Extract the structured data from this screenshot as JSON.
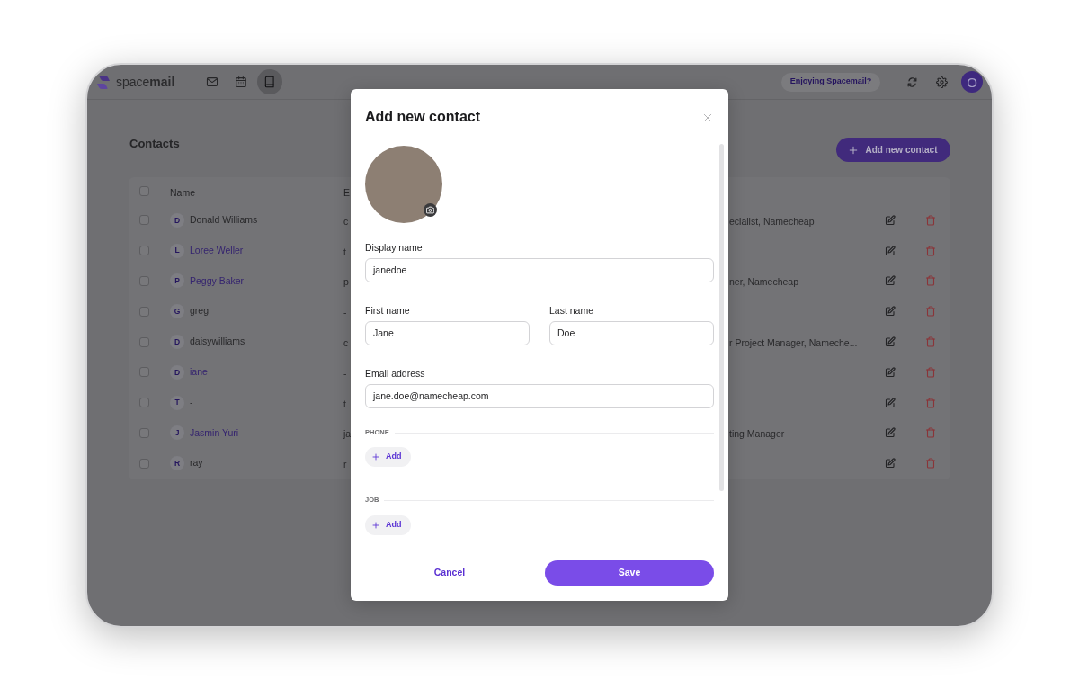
{
  "app": {
    "logo": "space**mail**",
    "nav": [
      {
        "kind": "mail",
        "selected": false
      },
      {
        "kind": "calendar",
        "selected": false
      },
      {
        "kind": "contacts",
        "selected": true
      }
    ],
    "feedback_button": "Enjoying Spacemail?",
    "avatar": "O"
  },
  "page": {
    "title": "Contacts",
    "add_button": "Add new contact"
  },
  "table": {
    "select_all": {
      "checked": false
    },
    "columns": [
      "Name",
      "E"
    ],
    "rows": [
      {
        "checked": false,
        "initial": "D",
        "name": "Donald Williams",
        "highlighted": false,
        "column_2": "c",
        "column_3": "ecialist, Namecheap"
      },
      {
        "checked": false,
        "initial": "L",
        "name": "Loree Weller",
        "highlighted": true,
        "column_2": "t"
      },
      {
        "checked": false,
        "initial": "P",
        "name": "Peggy Baker",
        "highlighted": true,
        "column_2": "p",
        "column_3": "ner, Namecheap"
      },
      {
        "checked": false,
        "initial": "G",
        "name": "greg",
        "highlighted": false,
        "column_2": "-"
      },
      {
        "checked": false,
        "initial": "D",
        "name": "daisywilliams",
        "highlighted": false,
        "column_2": "c",
        "column_3": "r Project Manager, Nameche..."
      },
      {
        "checked": false,
        "initial": "D",
        "name": "iane",
        "highlighted": true,
        "column_2": "-"
      },
      {
        "checked": false,
        "initial": "T",
        "name": "-",
        "highlighted": false,
        "column_2": "t"
      },
      {
        "checked": false,
        "initial": "J",
        "name": "Jasmin Yuri",
        "highlighted": true,
        "column_2": "ja",
        "column_3": "ting Manager"
      },
      {
        "checked": false,
        "initial": "R",
        "name": "ray",
        "highlighted": false,
        "column_2": "r"
      }
    ]
  },
  "dialog": {
    "title": "Add new contact",
    "fields": [
      [
        {
          "label": "Display name",
          "value": "janedoe"
        }
      ],
      [
        {
          "label": "First name",
          "value": "Jane"
        },
        {
          "label": "Last name",
          "value": "Doe"
        }
      ],
      [
        {
          "label": "Email address",
          "value": "jane.doe@namecheap.com"
        }
      ]
    ],
    "sections": [
      {
        "label": "PHONE",
        "button": "Add"
      },
      {
        "label": "JOB",
        "button": "Add"
      }
    ],
    "cancel": "Cancel",
    "save": "Save"
  }
}
